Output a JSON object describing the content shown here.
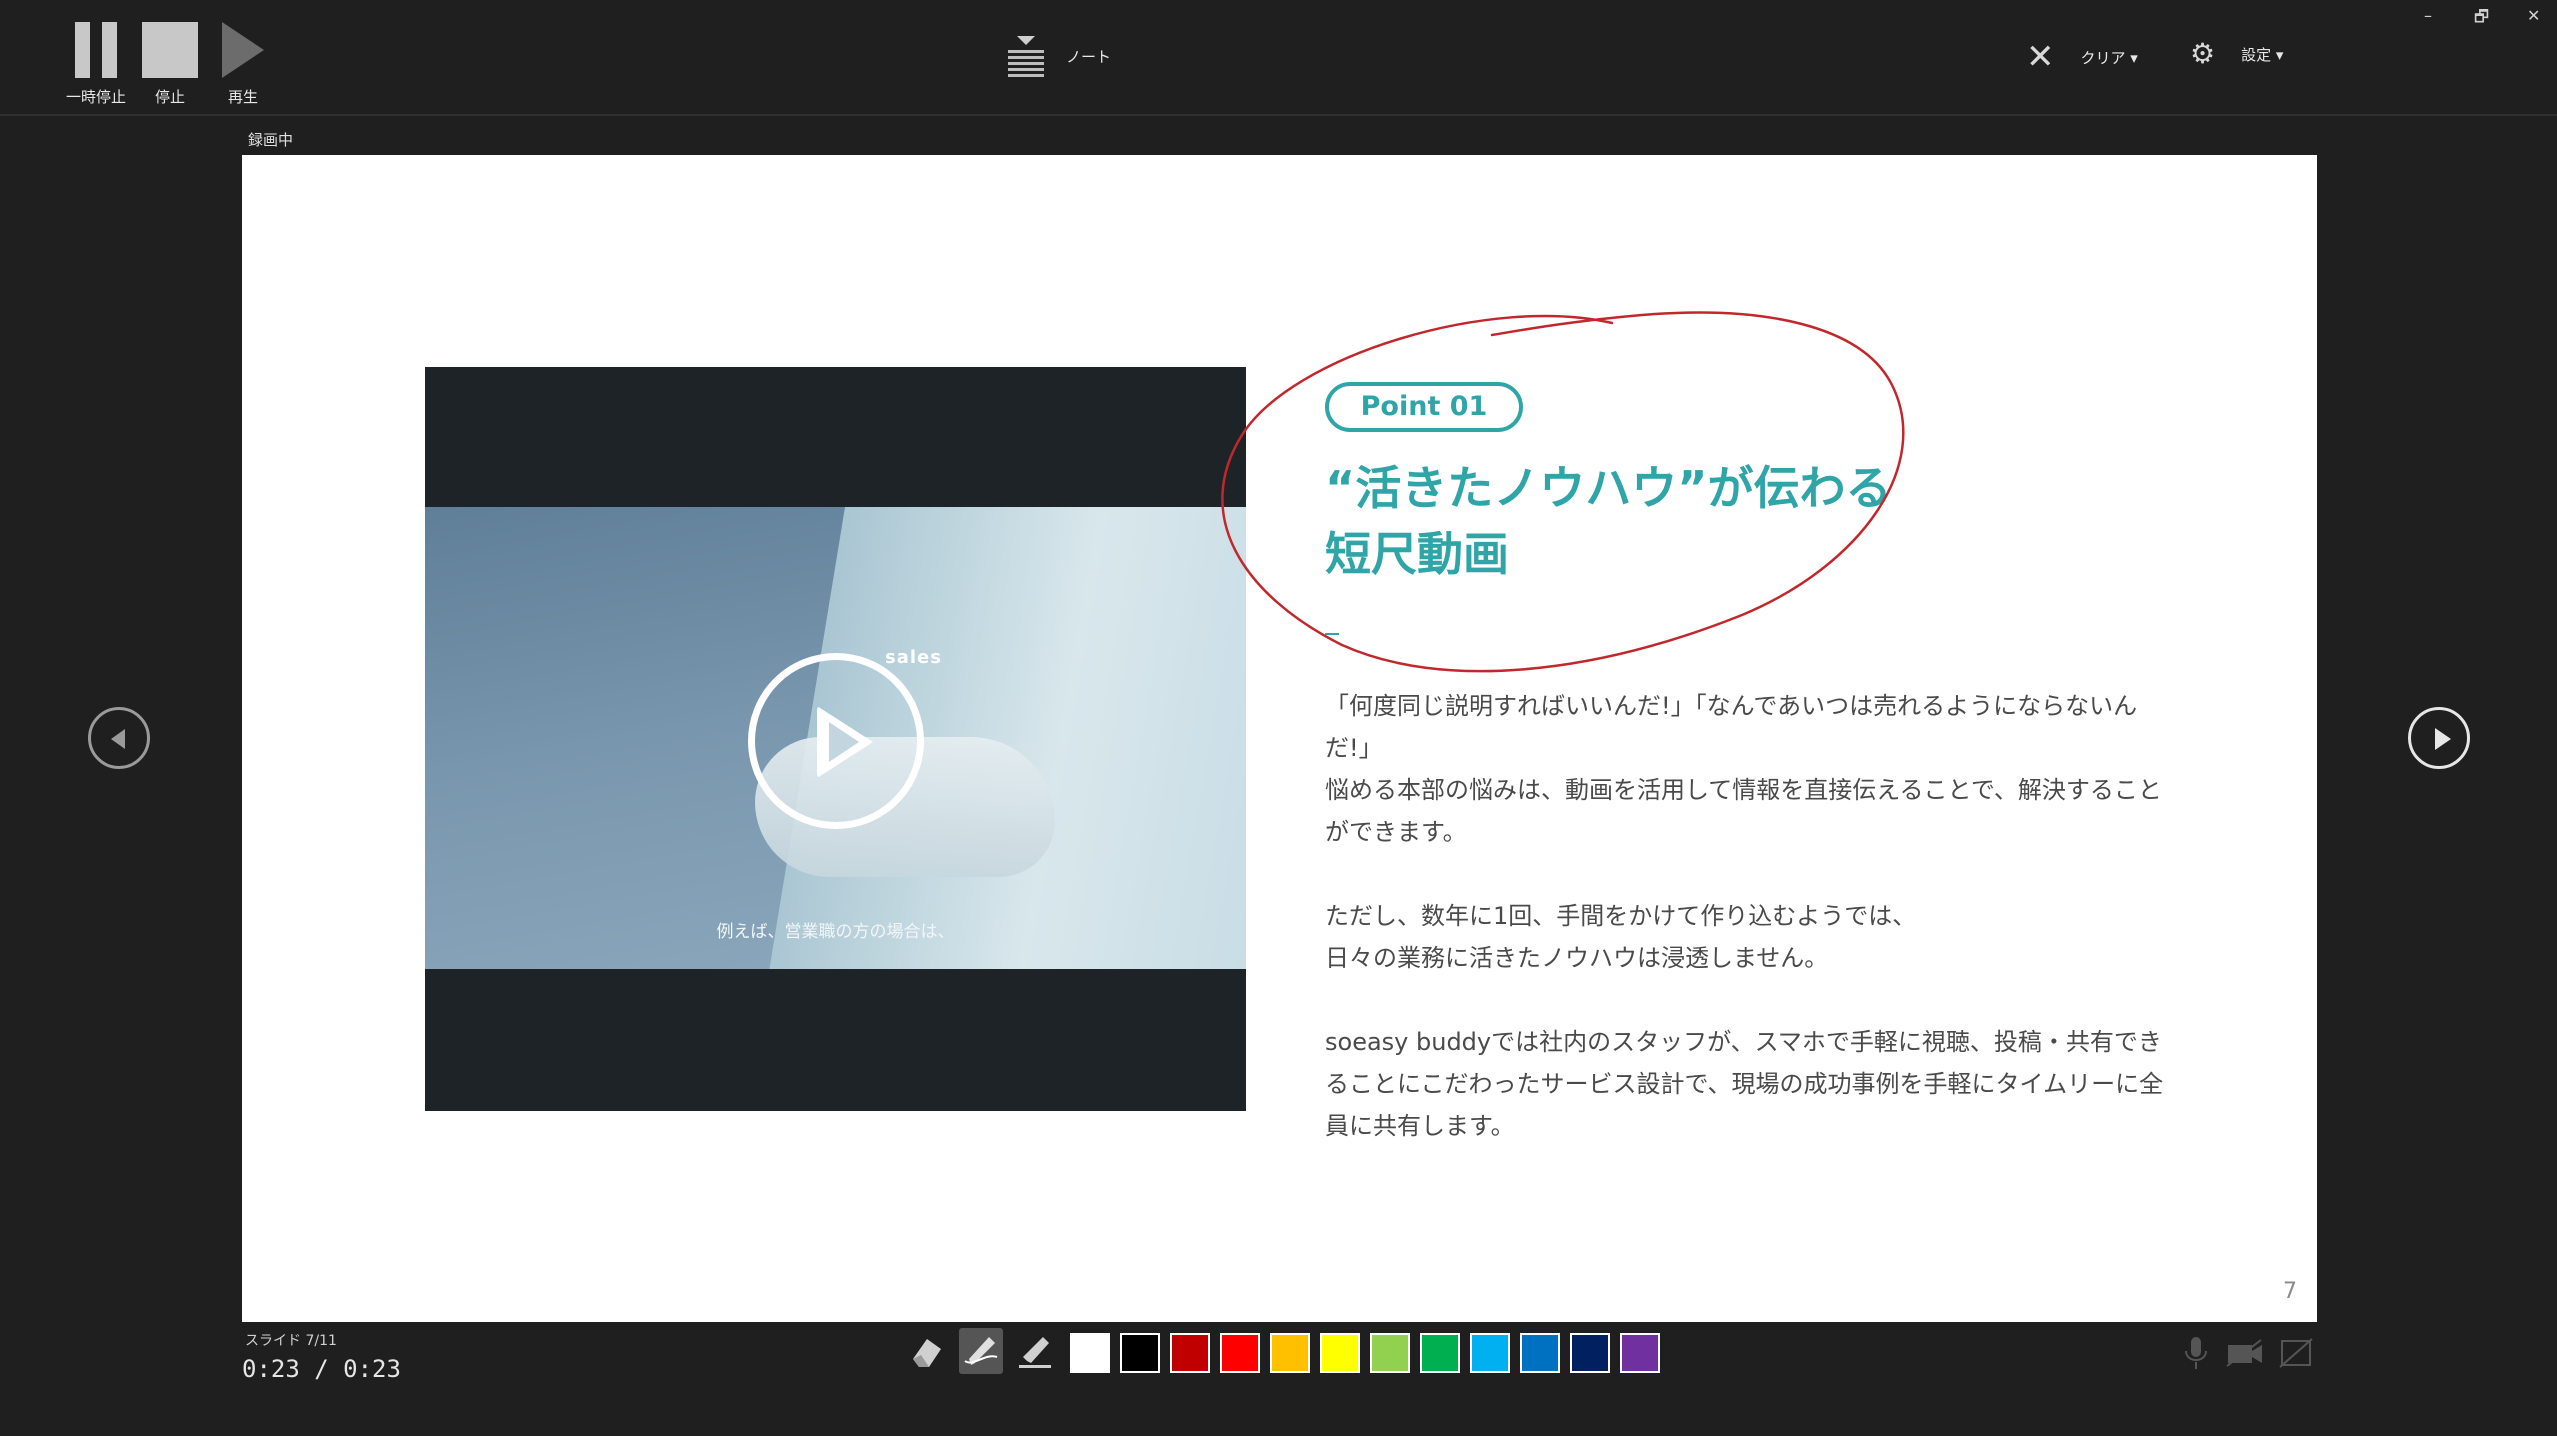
{
  "toolbar": {
    "pause_label": "一時停止",
    "stop_label": "停止",
    "play_label": "再生",
    "notes_label": "ノート",
    "clear_label": "クリア ▾",
    "settings_label": "設定 ▾"
  },
  "window_controls": {
    "minimize": "–",
    "restore": "🗗",
    "close": "✕"
  },
  "recording_label": "録画中",
  "slide": {
    "video": {
      "brand_text": "sales",
      "caption": "例えば、営業職の方の場合は、"
    },
    "point_label": "Point 01",
    "headline_line1": "“活きたノウハウ”が伝わる",
    "headline_line2": "短尺動画",
    "dash": "–",
    "paragraphs": [
      "「何度同じ説明すればいいんだ!」「なんであいつは売れるようにならないんだ!」",
      "悩める本部の悩みは、動画を活用して情報を直接伝えることで、解決することができます。",
      "ただし、数年に1回、手間をかけて作り込むようでは、",
      "日々の業務に活きたノウハウは浸透しません。",
      "soeasy buddyでは社内のスタッフが、スマホで手軽に視聴、投稿・共有できることにこだわったサービス設計で、現場の成功事例を手軽にタイムリーに全員に共有します。"
    ],
    "page_number": "7",
    "accent_color": "#2fa5a8",
    "annotation_color": "#c0282d"
  },
  "status": {
    "slide_count": "スライド 7/11",
    "timer": "0:23 / 0:23"
  },
  "pen_tools": [
    "eraser-icon",
    "pen-icon",
    "highlighter-icon"
  ],
  "ink_colors": [
    "#ffffff",
    "#000000",
    "#c00000",
    "#ff0000",
    "#ffc000",
    "#ffff00",
    "#92d050",
    "#00b050",
    "#00b0f0",
    "#0070c0",
    "#002060",
    "#7030a0"
  ]
}
